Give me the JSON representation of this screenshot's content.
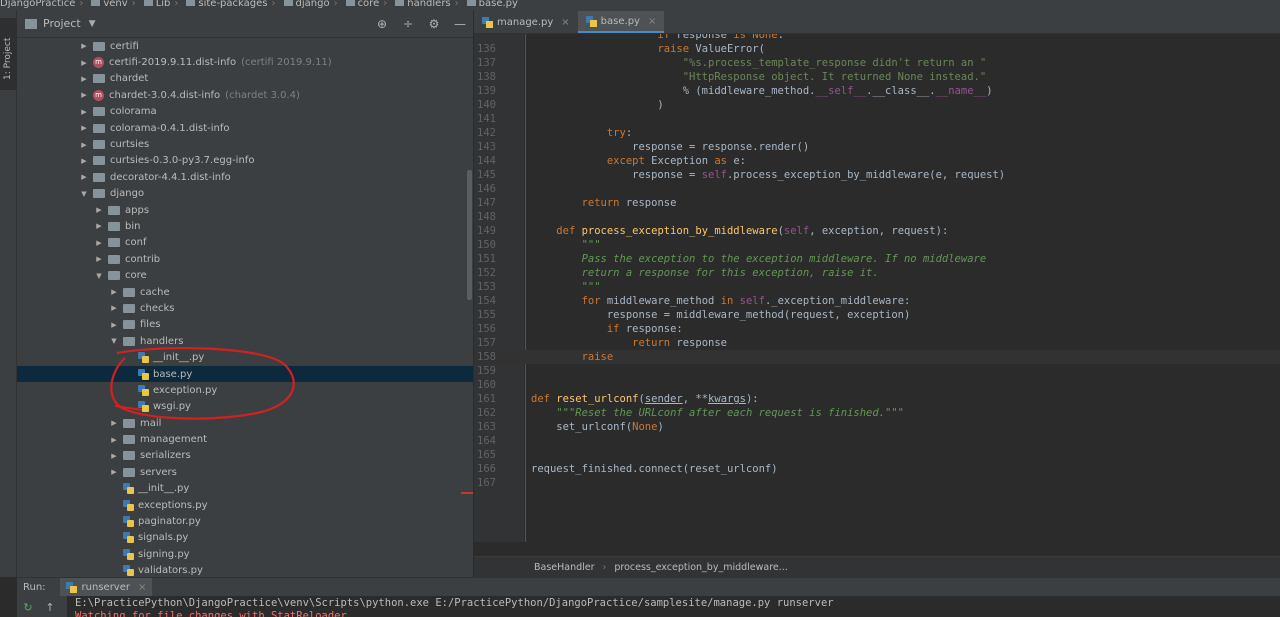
{
  "breadcrumbs": [
    "DjangoPractice",
    "venv",
    "Lib",
    "site-packages",
    "django",
    "core",
    "handlers",
    "base.py"
  ],
  "left_stripe": {
    "project_tab": "1: Project"
  },
  "project_panel": {
    "title": "Project",
    "tools": {
      "locate": "⊕",
      "collapse": "÷",
      "settings": "⚙",
      "hide": "—"
    },
    "tree": [
      {
        "name": "certifi",
        "type": "folder",
        "depth": 4,
        "arrow": "▶"
      },
      {
        "name": "certifi-2019.9.11.dist-info",
        "type": "meta",
        "depth": 4,
        "arrow": "▶",
        "hint": "(certifi 2019.9.11)"
      },
      {
        "name": "chardet",
        "type": "folder",
        "depth": 4,
        "arrow": "▶"
      },
      {
        "name": "chardet-3.0.4.dist-info",
        "type": "meta",
        "depth": 4,
        "arrow": "▶",
        "hint": "(chardet 3.0.4)"
      },
      {
        "name": "colorama",
        "type": "folder",
        "depth": 4,
        "arrow": "▶"
      },
      {
        "name": "colorama-0.4.1.dist-info",
        "type": "folder",
        "depth": 4,
        "arrow": "▶"
      },
      {
        "name": "curtsies",
        "type": "folder",
        "depth": 4,
        "arrow": "▶"
      },
      {
        "name": "curtsies-0.3.0-py3.7.egg-info",
        "type": "folder",
        "depth": 4,
        "arrow": "▶"
      },
      {
        "name": "decorator-4.4.1.dist-info",
        "type": "folder",
        "depth": 4,
        "arrow": "▶"
      },
      {
        "name": "django",
        "type": "folder",
        "depth": 4,
        "arrow": "▼"
      },
      {
        "name": "apps",
        "type": "folder",
        "depth": 5,
        "arrow": "▶"
      },
      {
        "name": "bin",
        "type": "folder",
        "depth": 5,
        "arrow": "▶"
      },
      {
        "name": "conf",
        "type": "folder",
        "depth": 5,
        "arrow": "▶"
      },
      {
        "name": "contrib",
        "type": "folder",
        "depth": 5,
        "arrow": "▶"
      },
      {
        "name": "core",
        "type": "folder",
        "depth": 5,
        "arrow": "▼"
      },
      {
        "name": "cache",
        "type": "folder",
        "depth": 6,
        "arrow": "▶"
      },
      {
        "name": "checks",
        "type": "folder",
        "depth": 6,
        "arrow": "▶"
      },
      {
        "name": "files",
        "type": "folder",
        "depth": 6,
        "arrow": "▶"
      },
      {
        "name": "handlers",
        "type": "folder",
        "depth": 6,
        "arrow": "▼"
      },
      {
        "name": "__init__.py",
        "type": "py",
        "depth": 7,
        "arrow": ""
      },
      {
        "name": "base.py",
        "type": "py",
        "depth": 7,
        "arrow": "",
        "selected": true
      },
      {
        "name": "exception.py",
        "type": "py",
        "depth": 7,
        "arrow": ""
      },
      {
        "name": "wsgi.py",
        "type": "py",
        "depth": 7,
        "arrow": ""
      },
      {
        "name": "mail",
        "type": "folder",
        "depth": 6,
        "arrow": "▶"
      },
      {
        "name": "management",
        "type": "folder",
        "depth": 6,
        "arrow": "▶"
      },
      {
        "name": "serializers",
        "type": "folder",
        "depth": 6,
        "arrow": "▶"
      },
      {
        "name": "servers",
        "type": "folder",
        "depth": 6,
        "arrow": "▶"
      },
      {
        "name": "__init__.py",
        "type": "py",
        "depth": 6,
        "arrow": ""
      },
      {
        "name": "exceptions.py",
        "type": "py",
        "depth": 6,
        "arrow": ""
      },
      {
        "name": "paginator.py",
        "type": "py",
        "depth": 6,
        "arrow": ""
      },
      {
        "name": "signals.py",
        "type": "py",
        "depth": 6,
        "arrow": ""
      },
      {
        "name": "signing.py",
        "type": "py",
        "depth": 6,
        "arrow": ""
      },
      {
        "name": "validators.py",
        "type": "py",
        "depth": 6,
        "arrow": ""
      }
    ]
  },
  "editor": {
    "tabs": [
      {
        "label": "manage.py",
        "active": false
      },
      {
        "label": "base.py",
        "active": true
      }
    ],
    "close_glyph": "×",
    "current_line": "158",
    "lines": [
      {
        "n": "",
        "html": "<span class='kw'>                    if</span><span class='tx'> response </span><span class='kw'>is</span><span class='tx'> </span><span class='kw'>None</span><span class='tx'>:</span>"
      },
      {
        "n": "136",
        "html": "<span class='tx'>                    </span><span class='kw'>raise</span><span class='tx'> ValueError(</span>"
      },
      {
        "n": "137",
        "html": "<span class='tx'>                        </span><span class='st'>\"%s.process_template_response didn't return an \"</span>"
      },
      {
        "n": "138",
        "html": "<span class='tx'>                        </span><span class='st'>\"HttpResponse object. It returned None instead.\"</span>"
      },
      {
        "n": "139",
        "html": "<span class='tx'>                        % (middleware_method.</span><span class='sf'>__self__</span><span class='tx'>.__class__.</span><span class='sf'>__name__</span><span class='tx'>)</span>"
      },
      {
        "n": "140",
        "html": "<span class='tx'>                    )</span>"
      },
      {
        "n": "141",
        "html": ""
      },
      {
        "n": "142",
        "html": "<span class='tx'>            </span><span class='kw'>try</span><span class='tx'>:</span>"
      },
      {
        "n": "143",
        "html": "<span class='tx'>                response = response.render()</span>"
      },
      {
        "n": "144",
        "html": "<span class='tx'>            </span><span class='kw'>except</span><span class='tx'> Exception </span><span class='kw'>as</span><span class='tx'> e:</span>"
      },
      {
        "n": "145",
        "html": "<span class='tx'>                response = </span><span class='sf'>self</span><span class='tx'>.process_exception_by_middleware(e, request)</span>"
      },
      {
        "n": "146",
        "html": ""
      },
      {
        "n": "147",
        "html": "<span class='tx'>        </span><span class='kw'>return</span><span class='tx'> response</span>"
      },
      {
        "n": "148",
        "html": ""
      },
      {
        "n": "149",
        "html": "<span class='tx'>    </span><span class='kw'>def</span><span class='tx'> </span><span class='fn'>process_exception_by_middleware</span><span class='tx'>(</span><span class='sf'>self</span><span class='tx'>, exception, request):</span>"
      },
      {
        "n": "150",
        "html": "<span class='tx'>        </span><span class='cm'>\"\"\"</span>"
      },
      {
        "n": "151",
        "html": "<span class='tx'>        </span><span class='cm'>Pass the exception to the exception middleware. If no middleware</span>"
      },
      {
        "n": "152",
        "html": "<span class='tx'>        </span><span class='cm'>return a response for this exception, raise it.</span>"
      },
      {
        "n": "153",
        "html": "<span class='tx'>        </span><span class='cm'>\"\"\"</span>"
      },
      {
        "n": "154",
        "html": "<span class='tx'>        </span><span class='kw'>for</span><span class='tx'> middleware_method </span><span class='kw'>in</span><span class='tx'> </span><span class='sf'>self</span><span class='tx'>._exception_middleware:</span>"
      },
      {
        "n": "155",
        "html": "<span class='tx'>            response = middleware_method(request, exception)</span>"
      },
      {
        "n": "156",
        "html": "<span class='tx'>            </span><span class='kw'>if</span><span class='tx'> response:</span>"
      },
      {
        "n": "157",
        "html": "<span class='tx'>                </span><span class='kw'>return</span><span class='tx'> response</span>"
      },
      {
        "n": "158",
        "html": "<span class='tx'>        </span><span class='kw'>raise</span>"
      },
      {
        "n": "159",
        "html": ""
      },
      {
        "n": "160",
        "html": ""
      },
      {
        "n": "161",
        "html": "<span class='kw'>def</span><span class='tx'> </span><span class='fn'>reset_urlconf</span><span class='tx'>(</span><span class='tx ul'>sender</span><span class='tx'>, **</span><span class='tx ul'>kwargs</span><span class='tx'>):</span>"
      },
      {
        "n": "162",
        "html": "<span class='tx'>    </span><span class='cm'>\"\"\"Reset the URLconf after each request is finished.\"\"\"</span>"
      },
      {
        "n": "163",
        "html": "<span class='tx'>    set_urlconf(</span><span class='kw'>None</span><span class='tx'>)</span>"
      },
      {
        "n": "164",
        "html": ""
      },
      {
        "n": "165",
        "html": ""
      },
      {
        "n": "166",
        "html": "<span class='tx'>request_finished.connect(reset_urlconf)</span>"
      },
      {
        "n": "167",
        "html": ""
      }
    ],
    "breadcrumb": [
      "BaseHandler",
      "process_exception_by_middleware..."
    ]
  },
  "run_panel": {
    "label": "Run:",
    "tab": "runserver",
    "rerun_glyph": "↻",
    "up_glyph": "↑",
    "console": [
      {
        "text": "E:\\PracticePython\\DjangoPractice\\venv\\Scripts\\python.exe E:/PracticePython/DjangoPractice/samplesite/manage.py runserver",
        "err": false
      },
      {
        "text": "Watching for file changes with StatReloader",
        "err": true
      }
    ]
  }
}
